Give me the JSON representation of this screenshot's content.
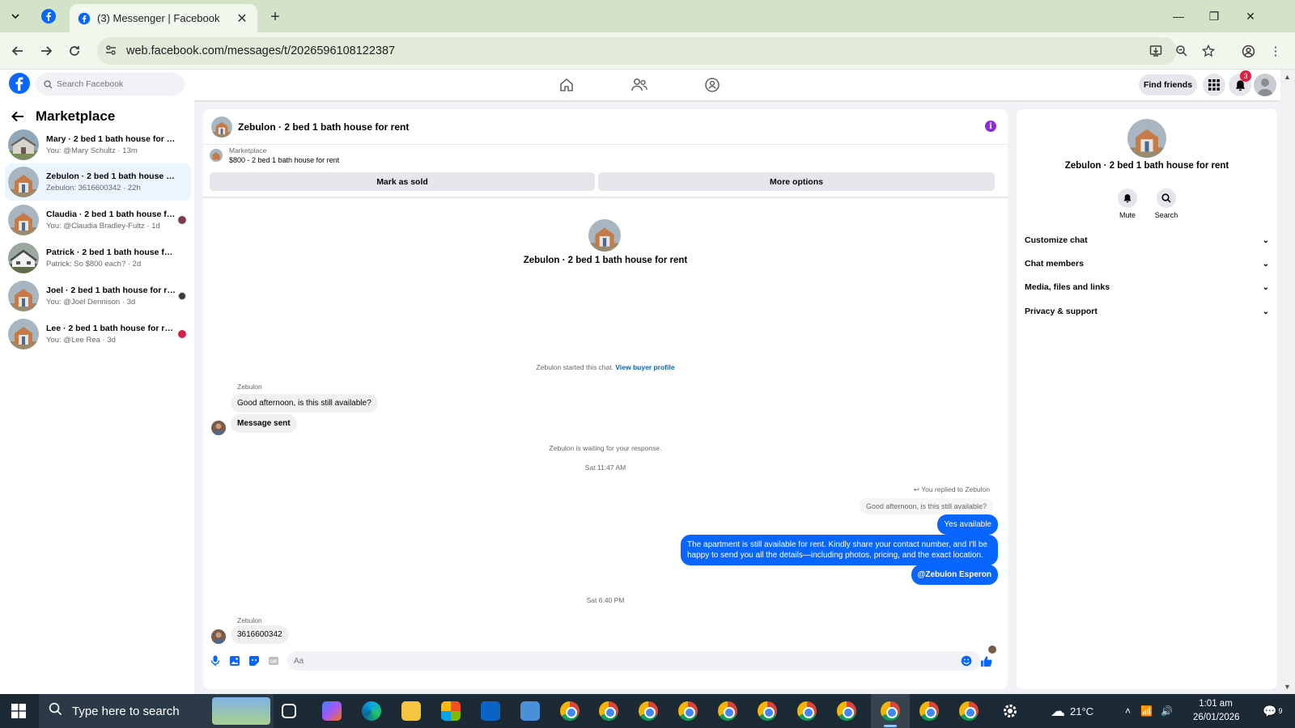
{
  "browser": {
    "tab_title": "(3) Messenger | Facebook",
    "url": "web.facebook.com/messages/t/2026596108122387"
  },
  "header": {
    "search_placeholder": "Search Facebook",
    "find_friends": "Find friends",
    "notification_count": "3"
  },
  "sidebar": {
    "title": "Marketplace",
    "conversations": [
      {
        "name": "Mary · 2 bed 1 bath house for rent",
        "preview": "You: @Mary Schultz · 13m",
        "active": false
      },
      {
        "name": "Zebulon · 2 bed 1 bath house for r...",
        "preview": "Zebulon: 3616600342 · 22h",
        "active": true
      },
      {
        "name": "Claudia · 2 bed 1 bath house for ...",
        "preview": "You: @Claudia Bradley-Fultz · 1d",
        "active": false
      },
      {
        "name": "Patrick · 2 bed 1 bath house for rent",
        "preview": "Patrick: So $800 each? · 2d",
        "active": false
      },
      {
        "name": "Joel · 2 bed 1 bath house for rent",
        "preview": "You: @Joel Dennison · 3d",
        "active": false
      },
      {
        "name": "Lee · 2 bed 1 bath house for rent",
        "preview": "You: @Lee Rea · 3d",
        "active": false
      }
    ]
  },
  "chat": {
    "title": "Zebulon · 2 bed 1 bath house for rent",
    "listing_source": "Marketplace",
    "listing_title": "$800 - 2 bed 1 bath house for rent",
    "mark_sold": "Mark as sold",
    "more_options": "More options",
    "center_name": "Zebulon · 2 bed 1 bath house for rent",
    "started": "Zebulon started this chat.",
    "view_profile": "View buyer profile",
    "sender": "Zebulon",
    "msg1": "Good afternoon, is this still available?",
    "msg2": "Message sent",
    "waiting": "Zebulon is waiting for your response.",
    "time1": "Sat 11:47 AM",
    "replied_to": "You replied to Zebulon",
    "quoted": "Good afternoon, is this still available?",
    "out1": "Yes available",
    "out2": "The apartment is still available for rent. Kindly share your contact number, and I'll be happy to send you all the details—including photos, pricing, and the exact location.",
    "out3": "@Zebulon Esperon",
    "time2": "Sat 6:40 PM",
    "sender2": "Zebulon",
    "msg3": "3616600342",
    "composer_placeholder": "Aa"
  },
  "right_panel": {
    "name": "Zebulon · 2 bed 1 bath house for rent",
    "mute": "Mute",
    "search": "Search",
    "sections": [
      "Customize chat",
      "Chat members",
      "Media, files and links",
      "Privacy & support"
    ]
  },
  "taskbar": {
    "search_placeholder": "Type here to search",
    "weather": "21°C",
    "time": "1:01 am",
    "date": "26/01/2026",
    "notifications": "9"
  },
  "colors": {
    "fb_blue": "#0866ff",
    "chrome_bg": "#d3e3c7",
    "badge_red": "#e41e3f"
  }
}
